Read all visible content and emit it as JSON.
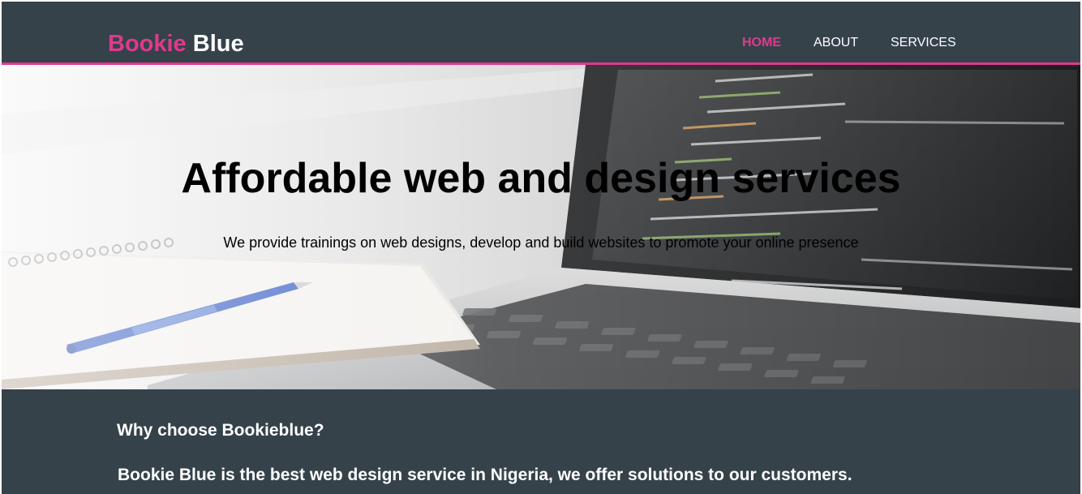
{
  "brand": {
    "first": "Bookie",
    "second": "Blue"
  },
  "nav": {
    "home": "HOME",
    "about": "ABOUT",
    "services": "SERVICES"
  },
  "hero": {
    "title": "Affordable web and design services",
    "subtitle": "We provide trainings on web designs, develop and build websites to promote your online presence"
  },
  "section": {
    "heading": "Why choose Bookieblue?",
    "text": "Bookie Blue is the best web design service in Nigeria, we offer solutions to our customers."
  },
  "colors": {
    "header_bg": "#35424a",
    "accent": "#e0398c",
    "text_light": "#ffffff"
  }
}
